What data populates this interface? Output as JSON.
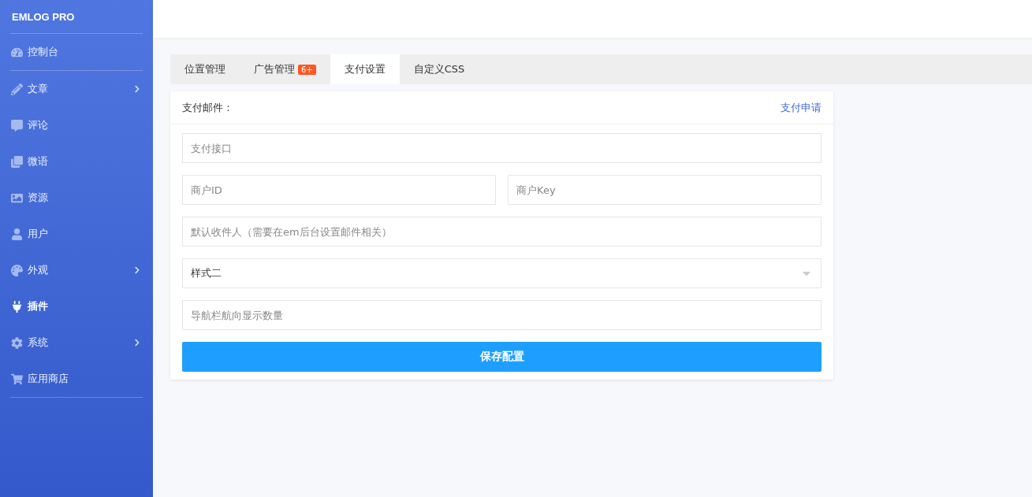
{
  "sidebar": {
    "brand": "EMLOG PRO",
    "items": [
      {
        "label": "控制台",
        "selected": false,
        "expandable": false
      },
      {
        "label": "文章",
        "selected": false,
        "expandable": true
      },
      {
        "label": "评论",
        "selected": false,
        "expandable": false
      },
      {
        "label": "微语",
        "selected": false,
        "expandable": false
      },
      {
        "label": "资源",
        "selected": false,
        "expandable": false
      },
      {
        "label": "用户",
        "selected": false,
        "expandable": false
      },
      {
        "label": "外观",
        "selected": false,
        "expandable": true
      },
      {
        "label": "插件",
        "selected": true,
        "expandable": false
      },
      {
        "label": "系统",
        "selected": false,
        "expandable": true
      },
      {
        "label": "应用商店",
        "selected": false,
        "expandable": false
      }
    ]
  },
  "tabs": [
    {
      "label": "位置管理",
      "selected": false
    },
    {
      "label": "广告管理",
      "selected": false,
      "badge": "6+"
    },
    {
      "label": "支付设置",
      "selected": true
    },
    {
      "label": "自定义CSS",
      "selected": false
    }
  ],
  "card": {
    "title": "支付邮件：",
    "link": "支付申请",
    "rows": [
      [
        {
          "kind": "input",
          "placeholder": "支付接口"
        }
      ],
      [
        {
          "kind": "input",
          "placeholder": "商户ID"
        },
        {
          "kind": "input",
          "placeholder": "商户Key"
        }
      ],
      [
        {
          "kind": "input",
          "placeholder": "默认收件人（需要在em后台设置邮件相关）"
        }
      ],
      [
        {
          "kind": "select",
          "value": "样式二"
        }
      ],
      [
        {
          "kind": "input",
          "placeholder": "导航栏航向显示数量"
        }
      ]
    ],
    "button": "保存配置"
  }
}
